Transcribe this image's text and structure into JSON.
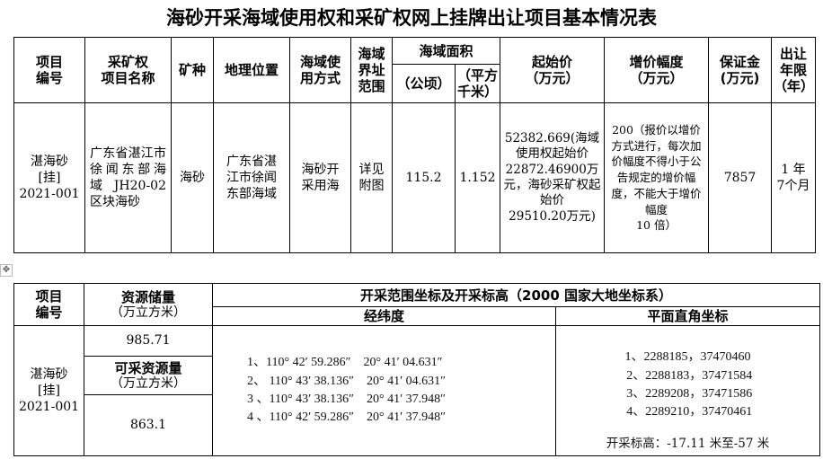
{
  "title": "海砂开采海域使用权和采矿权网上挂牌出让项目基本情况表",
  "table1": {
    "headers": {
      "project_no": "项目\n编号",
      "mining_name": "采矿权\n项目名称",
      "mineral": "矿种",
      "location": "地理位置",
      "sea_use": "海域使\n用方式",
      "boundary": "海域\n界址\n范围",
      "area": "海域面积",
      "area_ha": "（公顷）",
      "area_km2": "（平方\n千米）",
      "start_price": "起始价\n（万元）",
      "increment": "增价幅度\n（万元）",
      "deposit": "保证金\n(万元)",
      "term": "出让\n年限\n（年）"
    },
    "row": {
      "project_no": "湛海砂\n[挂]\n2021-001",
      "mining_name": "广东省湛江市徐闻东部海　　域JH20-02 区块海砂",
      "mineral": "海砂",
      "location": "广东省湛江市徐闻东部海域",
      "sea_use": "海砂开\n采用海",
      "boundary": "详见\n附图",
      "area_ha": "115.2",
      "area_km2": "1.152",
      "start_price": "52382.669(海域使用权起始价\n22872.46900万元，海砂采矿权起始价\n29510.20万元)",
      "increment": "200（报价以增价方式进行，每次加价幅度不得小于公告规定的增价幅度，不能大于增价幅度\n10 倍）",
      "deposit": "7857",
      "term": "1 年\n7个月"
    }
  },
  "table2": {
    "headers": {
      "project_no": "项目\n编号",
      "reserves": "资源储量",
      "reserves_unit": "（万立方米）",
      "range_title": "开采范围坐标及开采标高（2000 国家大地坐标系）",
      "latlon": "经纬度",
      "plane": "平面直角坐标"
    },
    "row": {
      "project_no": "湛海砂\n[挂]\n2021-001",
      "reserves_value": "985.71",
      "minable_label": "可采资源量",
      "minable_unit": "（万立方米）",
      "minable_value": "863.1",
      "latlon": [
        "1、110° 42′ 59.286″　20° 41′ 04.631″",
        "2、 110° 43′ 38.136″　20° 41′ 04.631″",
        "3 、110° 43′ 38.136″　20° 41′ 37.948″",
        "4 、110° 42′ 59.286″　20° 41′ 37.948″"
      ],
      "plane": [
        "1、2288185，37470460",
        " 2、2288183，37471584",
        " 3、2289208，37471586",
        " 4、2289210，37470461"
      ],
      "elevation": "开采标高：-17.11 米至-57 米"
    }
  },
  "table_move_handle": "✥"
}
